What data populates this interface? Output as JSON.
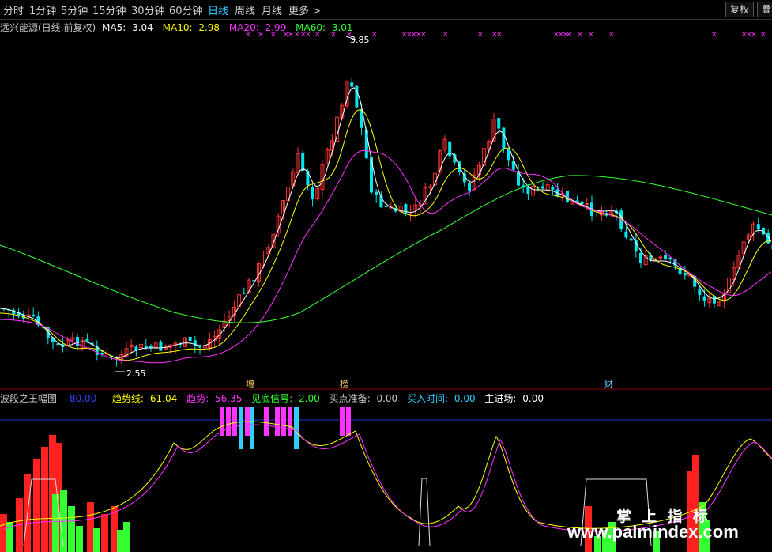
{
  "toolbar": {
    "periods": [
      "分时",
      "1分钟",
      "5分钟",
      "15分钟",
      "30分钟",
      "60分钟",
      "日线",
      "周线",
      "月线",
      "更多 >"
    ],
    "active_period": "日线",
    "fuquan_button": "复权",
    "overlay_button": "叠加"
  },
  "main_chart": {
    "stock_name": "远兴能源(日线,前复权)",
    "ma5": {
      "label": "MA5:",
      "value": "3.04",
      "color": "#ffffff"
    },
    "ma10": {
      "label": "MA10:",
      "value": "2.98",
      "color": "#ffff00"
    },
    "ma20": {
      "label": "MA20:",
      "value": "2.99",
      "color": "#ff33ff"
    },
    "ma60": {
      "label": "MA60:",
      "value": "3.01",
      "color": "#33ff33"
    },
    "high_label": "3.85",
    "low_label": "2.55",
    "signal_labels": [
      "增",
      "榜",
      "财"
    ],
    "colors": {
      "up": "#ff3232",
      "down": "#00e5ee",
      "marker": "#ff33ff"
    }
  },
  "indicator": {
    "name": "波段之王幅图",
    "level": "80.00",
    "trend_line": {
      "label": "趋势线:",
      "value": "61.04",
      "color": "#ffff00"
    },
    "trend": {
      "label": "趋势:",
      "value": "56.35",
      "color": "#ff33ff"
    },
    "bottom_signal": {
      "label": "见底信号:",
      "value": "2.00",
      "color": "#33ff33"
    },
    "buy_prepare": {
      "label": "买点准备:",
      "value": "0.00",
      "color": "#c8c8c8"
    },
    "buy_time": {
      "label": "买入时间:",
      "value": "0.00",
      "color": "#33ccff"
    },
    "main_entry": {
      "label": "主进场:",
      "value": "0.00",
      "color": "#ffffff"
    }
  },
  "watermark": {
    "title": "掌 上 指 标",
    "url": "www.palmindex.com"
  }
}
